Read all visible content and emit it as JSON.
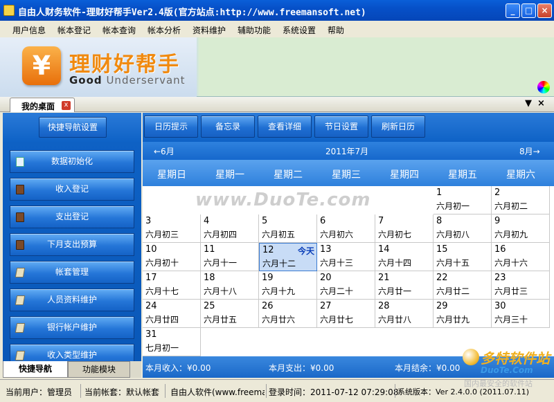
{
  "window": {
    "title": "自由人财务软件-理财好帮手Ver2.4版(官方站点:http://www.freemansoft.net)",
    "min": "_",
    "max": "□",
    "close": "×"
  },
  "menu": [
    "用户信息",
    "帐本登记",
    "帐本查询",
    "帐本分析",
    "资料维护",
    "辅助功能",
    "系统设置",
    "帮助"
  ],
  "banner": {
    "icon_glyph": "¥",
    "title_cn": "理财好帮手",
    "title_en_1": "Good",
    "title_en_2": "Underservant"
  },
  "tabs": {
    "desk": "我的桌面",
    "close_glyph": "x",
    "menu_glyph": "▼",
    "close_all_glyph": "×"
  },
  "left": {
    "quick_nav_setting": "快捷导航设置",
    "items": [
      "数据初始化",
      "收入登记",
      "支出登记",
      "下月支出预算",
      "帐套管理",
      "人员资料维护",
      "银行帐户维护",
      "收入类型维护"
    ],
    "tab_quick": "快捷导航",
    "tab_func": "功能模块"
  },
  "toolbar": [
    "日历提示",
    "备忘录",
    "查看详细",
    "节日设置",
    "刷新日历"
  ],
  "calendar": {
    "prev": "←6月",
    "title": "2011年7月",
    "next": "8月→",
    "weekdays": [
      "星期日",
      "星期一",
      "星期二",
      "星期三",
      "星期四",
      "星期五",
      "星期六"
    ],
    "today_label": "今天",
    "today": 12,
    "first_weekday": 5,
    "days": [
      [
        "1",
        "六月初一"
      ],
      [
        "2",
        "六月初二"
      ],
      [
        "3",
        "六月初三"
      ],
      [
        "4",
        "六月初四"
      ],
      [
        "5",
        "六月初五"
      ],
      [
        "6",
        "六月初六"
      ],
      [
        "7",
        "六月初七"
      ],
      [
        "8",
        "六月初八"
      ],
      [
        "9",
        "六月初九"
      ],
      [
        "10",
        "六月初十"
      ],
      [
        "11",
        "六月十一"
      ],
      [
        "12",
        "六月十二"
      ],
      [
        "13",
        "六月十三"
      ],
      [
        "14",
        "六月十四"
      ],
      [
        "15",
        "六月十五"
      ],
      [
        "16",
        "六月十六"
      ],
      [
        "17",
        "六月十七"
      ],
      [
        "18",
        "六月十八"
      ],
      [
        "19",
        "六月十九"
      ],
      [
        "20",
        "六月二十"
      ],
      [
        "21",
        "六月廿一"
      ],
      [
        "22",
        "六月廿二"
      ],
      [
        "23",
        "六月廿三"
      ],
      [
        "24",
        "六月廿四"
      ],
      [
        "25",
        "六月廿五"
      ],
      [
        "26",
        "六月廿六"
      ],
      [
        "27",
        "六月廿七"
      ],
      [
        "28",
        "六月廿八"
      ],
      [
        "29",
        "六月廿九"
      ],
      [
        "30",
        "六月三十"
      ],
      [
        "31",
        "七月初一"
      ]
    ],
    "watermark": "www.DuoTe.com"
  },
  "summary": {
    "income": "本月收入：¥0.00",
    "expense": "本月支出：¥0.00",
    "balance": "本月结余：¥0.00"
  },
  "status": {
    "user": "当前用户：管理员",
    "account": "当前帐套：默认帐套",
    "vendor": "自由人软件(www.freemans",
    "login": "登录时间：2011-07-12 07:29:08",
    "version": "系统版本：Ver 2.4.0.0 (2011.07.11)"
  },
  "site_logo": {
    "line1": "多特软件站",
    "line2": "DuoTe.Com",
    "line3": "国内最安全的软件站"
  }
}
